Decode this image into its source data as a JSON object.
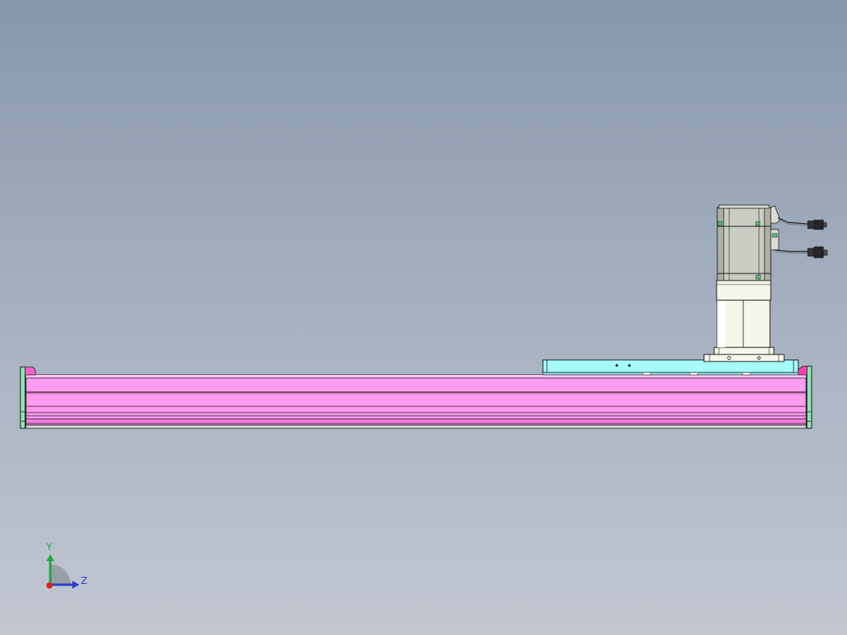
{
  "view": {
    "background_top": "#8797ab",
    "background_bottom": "#c2c7d1"
  },
  "triad": {
    "y_label": "Y",
    "z_label": "Z",
    "y_color": "#21a83a",
    "z_color": "#2a3fd0",
    "x_color": "#e02020"
  },
  "model": {
    "rail_color": "#ff9bf0",
    "carriage_color": "#a6fbfb",
    "end_cap_color": "#8fe6b6",
    "motor_body_color": "#c9ccc2",
    "reducer_color": "#f6f6ea",
    "edge_color": "#1a1a1a"
  }
}
